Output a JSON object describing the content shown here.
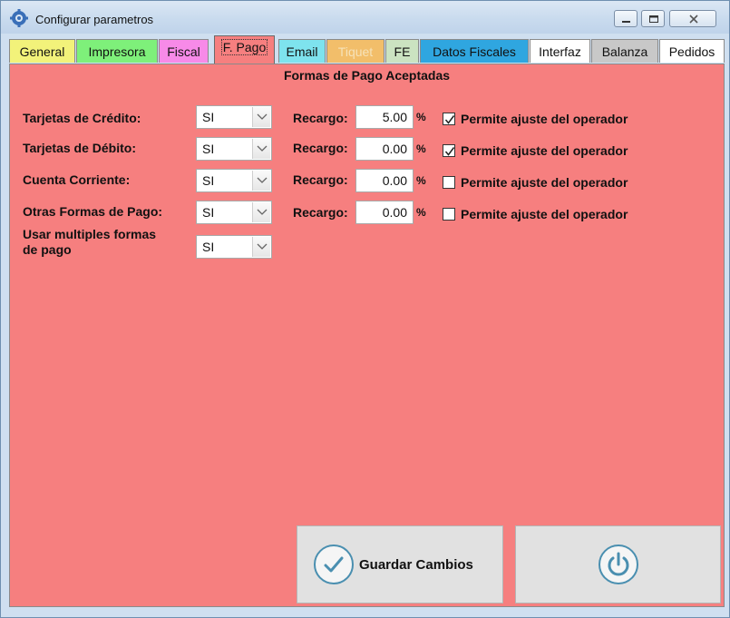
{
  "window": {
    "title": "Configurar parametros"
  },
  "tabs": [
    {
      "label": "General",
      "color": "#f2f27a"
    },
    {
      "label": "Impresora",
      "color": "#7ef07a"
    },
    {
      "label": "Fiscal",
      "color": "#f78ae8"
    },
    {
      "label": "F. Pago",
      "color": "#f67f7f",
      "active": true
    },
    {
      "label": "Email",
      "color": "#7ee3ee"
    },
    {
      "label": "Tiquet",
      "color": "#f2be6a",
      "disabled": true
    },
    {
      "label": "FE",
      "color": "#cbe3c1"
    },
    {
      "label": "Datos Fiscales",
      "color": "#2fa6e0"
    },
    {
      "label": "Interfaz",
      "color": "#ffffff"
    },
    {
      "label": "Balanza",
      "color": "#c8c8c8"
    },
    {
      "label": "Pedidos",
      "color": "#ffffff"
    }
  ],
  "panel": {
    "title": "Formas de Pago Aceptadas",
    "rows": [
      {
        "label": "Tarjetas de Crédito:",
        "select": "SI",
        "recargo_label": "Recargo:",
        "recargo": "5.00",
        "unit": "%",
        "ajuste_checked": true,
        "ajuste_label": "Permite ajuste del operador"
      },
      {
        "label": "Tarjetas de Débito:",
        "select": "SI",
        "recargo_label": "Recargo:",
        "recargo": "0.00",
        "unit": "%",
        "ajuste_checked": true,
        "ajuste_label": "Permite ajuste del operador"
      },
      {
        "label": "Cuenta Corriente:",
        "select": "SI",
        "recargo_label": "Recargo:",
        "recargo": "0.00",
        "unit": "%",
        "ajuste_checked": false,
        "ajuste_label": "Permite ajuste del operador"
      },
      {
        "label": "Otras Formas de Pago:",
        "select": "SI",
        "recargo_label": "Recargo:",
        "recargo": "0.00",
        "unit": "%",
        "ajuste_checked": false,
        "ajuste_label": "Permite ajuste del operador"
      }
    ],
    "multiple": {
      "label_line1": "Usar multiples formas",
      "label_line2": "de pago",
      "select": "SI"
    }
  },
  "buttons": {
    "save_label": "Guardar Cambios",
    "save_icon": "check-icon",
    "exit_icon": "power-icon"
  },
  "colors": {
    "panel": "#f67f7f",
    "icon_accent": "#4a8fb0"
  }
}
